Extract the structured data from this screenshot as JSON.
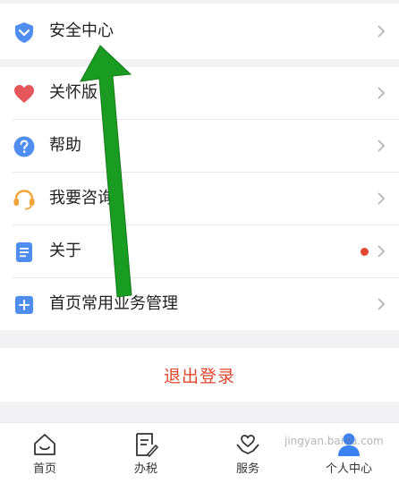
{
  "menu": {
    "security": {
      "label": "安全中心",
      "icon": "shield-icon"
    },
    "items": [
      {
        "label": "关怀版",
        "icon": "heart-icon"
      },
      {
        "label": "帮助",
        "icon": "help-icon"
      },
      {
        "label": "我要咨询",
        "icon": "headset-icon"
      },
      {
        "label": "关于",
        "icon": "document-icon",
        "badge": "red-dot"
      },
      {
        "label": "首页常用业务管理",
        "icon": "grid-plus-icon"
      }
    ]
  },
  "logout_label": "退出登录",
  "tabbar": {
    "active": "个人中心",
    "tabs": [
      {
        "label": "首页",
        "icon": "home-icon"
      },
      {
        "label": "办税",
        "icon": "edit-icon"
      },
      {
        "label": "服务",
        "icon": "heart-hands-icon"
      },
      {
        "label": "个人中心",
        "icon": "person-icon"
      }
    ]
  },
  "colors": {
    "accent_blue": "#3b82f6",
    "logout_red": "#e2472f",
    "annotation_green": "#1a9c22"
  }
}
